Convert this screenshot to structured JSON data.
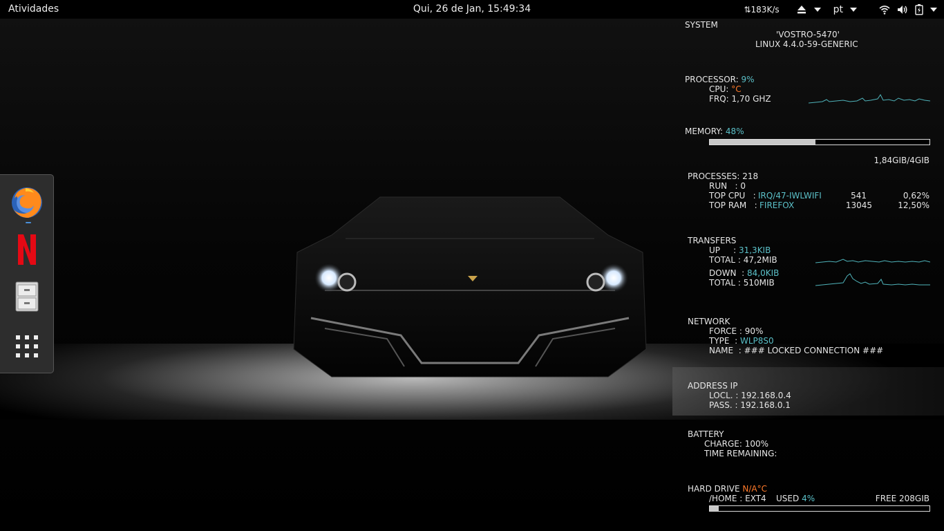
{
  "topbar": {
    "activities": "Atividades",
    "clock": "Qui, 26 de Jan, 15:49:34",
    "net_speed": "⇅183K/s",
    "language": "pt"
  },
  "dock": {
    "apps": [
      "Firefox",
      "Netflix",
      "Files",
      "Show Applications"
    ]
  },
  "conky": {
    "system": {
      "header": "SYSTEM",
      "hostname": "'VOSTRO-5470'",
      "kernel": "LINUX 4.4.0-59-GENERIC"
    },
    "processor": {
      "header": "PROCESSOR:",
      "usage": "9%",
      "cpu_label": "CPU:",
      "cpu_temp": "°C",
      "frq": "FRQ: 1,70 GHZ"
    },
    "memory": {
      "header": "MEMORY:",
      "usage": "48%",
      "usage_fraction": 0.48,
      "amount": "1,84GIB/4GIB"
    },
    "processes": {
      "header": "PROCESSES: 218",
      "run": "RUN   : 0",
      "top_cpu_label": "TOP CPU   :",
      "top_cpu_name": "IRQ/47-IWLWIFI",
      "top_cpu_pid": "541",
      "top_cpu_pct": "0,62%",
      "top_ram_label": "TOP RAM   :",
      "top_ram_name": "FIREFOX",
      "top_ram_pid": "13045",
      "top_ram_pct": "12,50%"
    },
    "transfers": {
      "header": "TRANSFERS",
      "up_label": "UP     :",
      "up_value": "31,3KIB",
      "up_total": "TOTAL : 47,2MIB",
      "down_label": "DOWN  :",
      "down_value": "84,0KIB",
      "down_total": "TOTAL : 510MIB"
    },
    "network": {
      "header": "NETWORK",
      "force": "FORCE : 90%",
      "type_label": "TYPE  :",
      "type_value": "WLP8S0",
      "name": "NAME  : ### LOCKED CONNECTION ###"
    },
    "address": {
      "header": "ADDRESS IP",
      "local": "LOCL. : 192.168.0.4",
      "gateway": "PASS. : 192.168.0.1"
    },
    "battery": {
      "header": "BATTERY",
      "charge": "CHARGE: 100%",
      "remaining": "TIME REMAINING:"
    },
    "hard_drive": {
      "header": "HARD DRIVE",
      "temp": "N/A°C",
      "mount": "/HOME : EXT4",
      "used_label": "USED",
      "used_value": "4%",
      "used_fraction": 0.04,
      "free": "FREE 208GIB"
    }
  },
  "colors": {
    "accent_cyan": "#5bc0c8",
    "accent_orange": "#ff7a2a",
    "dock_bg": "#2d2d2d",
    "bar_fill": "#c8c8c8"
  }
}
